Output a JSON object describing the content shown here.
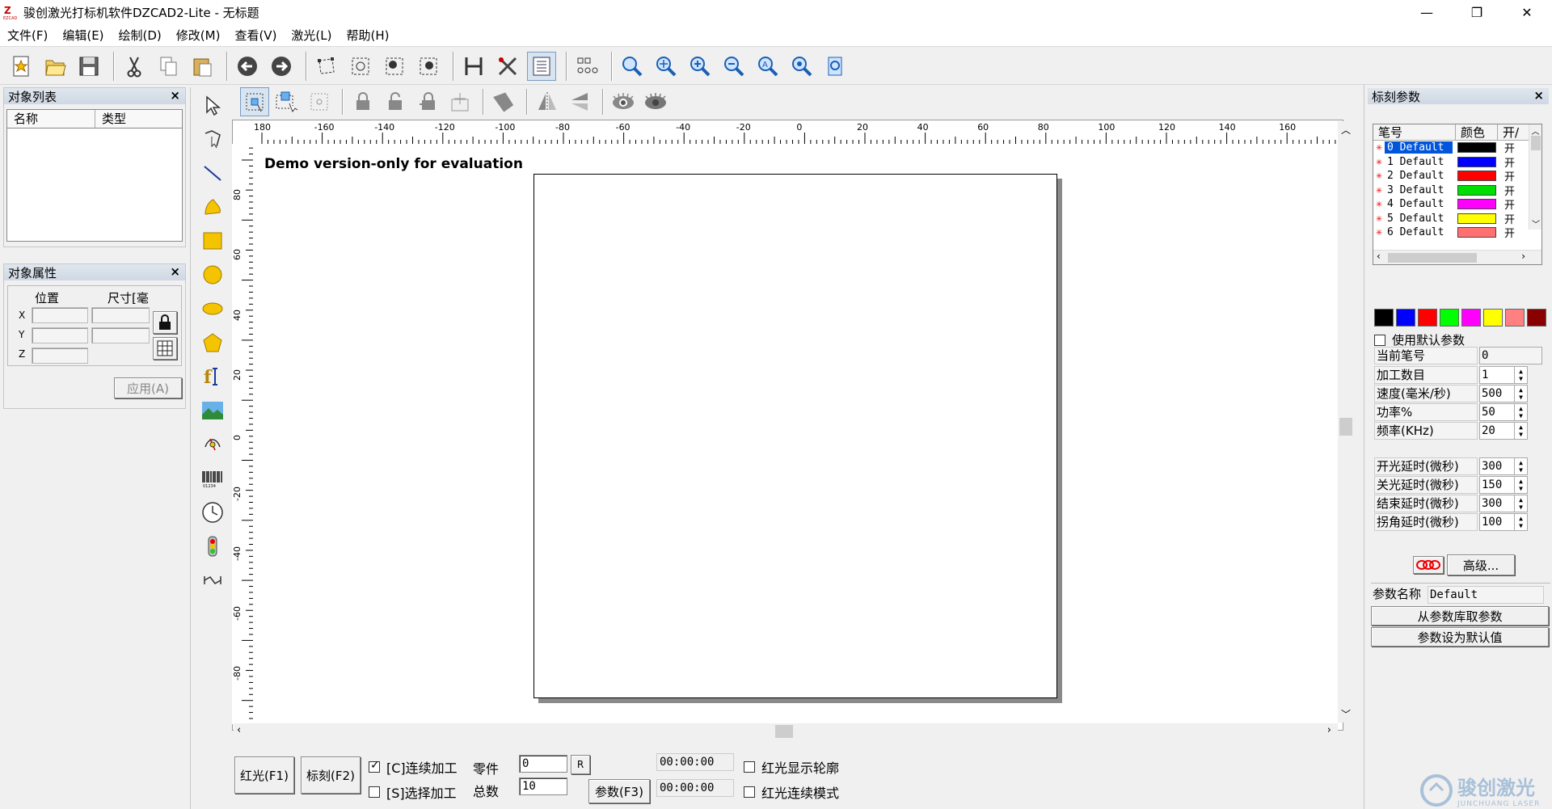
{
  "window": {
    "title": "骏创激光打标机软件DZCAD2-Lite  - 无标题"
  },
  "menu": [
    "文件(F)",
    "编辑(E)",
    "绘制(D)",
    "修改(M)",
    "查看(V)",
    "激光(L)",
    "帮助(H)"
  ],
  "panels": {
    "object_list": {
      "title": "对象列表",
      "col_name": "名称",
      "col_type": "类型",
      "close": "×"
    },
    "object_props": {
      "title": "对象属性",
      "position": "位置",
      "size": "尺寸[毫",
      "x": "X",
      "y": "Y",
      "z": "Z",
      "apply": "应用(A)",
      "close": "×"
    }
  },
  "canvas": {
    "demo_text": "Demo version-only for evaluation",
    "ruler_top": [
      "180",
      "-160",
      "-140",
      "-120",
      "-100",
      "-80",
      "-60",
      "-40",
      "-20",
      "0",
      "20",
      "40",
      "60",
      "80",
      "100",
      "120",
      "140",
      "160",
      "180"
    ],
    "ruler_left": [
      "80",
      "60",
      "40",
      "20",
      "0",
      "-20",
      "-40",
      "-60",
      "-80"
    ]
  },
  "bottom": {
    "red_light": "红光(F1)",
    "mark": "标刻(F2)",
    "continuous": "[C]连续加工",
    "continuous_checked": true,
    "select_process": "[S]选择加工",
    "parts_label": "零件",
    "parts_value": "0",
    "total_label": "总数",
    "total_value": "10",
    "reset": "R",
    "params": "参数(F3)",
    "time1": "00:00:00",
    "time2": "00:00:00",
    "red_outline": "红光显示轮廓",
    "red_continuous": "红光连续模式"
  },
  "right_panel": {
    "title": "标刻参数",
    "close": "×",
    "pen_headers": [
      "笔号",
      "颜色",
      "开/"
    ],
    "pens": [
      {
        "name": "0 Default",
        "color": "#000000",
        "on": "开"
      },
      {
        "name": "1 Default",
        "color": "#0000ff",
        "on": "开"
      },
      {
        "name": "2 Default",
        "color": "#ff0000",
        "on": "开"
      },
      {
        "name": "3 Default",
        "color": "#00dd00",
        "on": "开"
      },
      {
        "name": "4 Default",
        "color": "#ff00ff",
        "on": "开"
      },
      {
        "name": "5 Default",
        "color": "#ffff00",
        "on": "开"
      },
      {
        "name": "6 Default",
        "color": "#ff7070",
        "on": "开"
      }
    ],
    "palette": [
      "#000000",
      "#0000ff",
      "#ff0000",
      "#00ff00",
      "#ff00ff",
      "#ffff00",
      "#ff8080",
      "#880000"
    ],
    "use_default": "使用默认参数",
    "current_pen": {
      "label": "当前笔号",
      "value": "0"
    },
    "params": [
      {
        "label": "加工数目",
        "value": "1"
      },
      {
        "label": "速度(毫米/秒)",
        "value": "500"
      },
      {
        "label": "功率%",
        "value": "50"
      },
      {
        "label": "频率(KHz)",
        "value": "20"
      }
    ],
    "delays": [
      {
        "label": "开光延时(微秒)",
        "value": "300"
      },
      {
        "label": "关光延时(微秒)",
        "value": "150"
      },
      {
        "label": "结束延时(微秒)",
        "value": "300"
      },
      {
        "label": "拐角延时(微秒)",
        "value": "100"
      }
    ],
    "advanced": "高级...",
    "param_name_label": "参数名称",
    "param_name_value": "Default",
    "from_lib": "从参数库取参数",
    "set_default": "参数设为默认值"
  },
  "watermark": {
    "cn": "骏创激光",
    "en": "JUNCHUANG LASER"
  },
  "accent": "#0055dd"
}
